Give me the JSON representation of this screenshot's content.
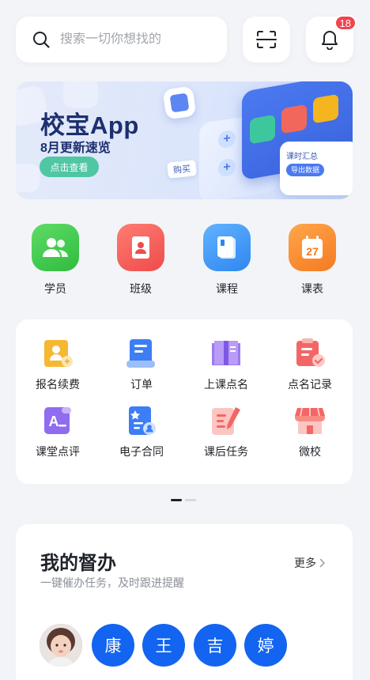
{
  "search": {
    "placeholder": "搜索一切你想找的"
  },
  "notifications": {
    "count": "18"
  },
  "banner": {
    "title": "校宝App",
    "subtitle": "8月更新速览",
    "button": "点击查看",
    "deco_buy": "购买",
    "deco_summary": "课时汇总",
    "deco_export": "导出数据"
  },
  "quick": [
    {
      "label": "学员",
      "icon": "students-icon",
      "color": "#3ecb4f"
    },
    {
      "label": "班级",
      "icon": "class-icon",
      "color": "#f45b5b"
    },
    {
      "label": "课程",
      "icon": "course-icon",
      "color": "#3b95f5"
    },
    {
      "label": "课表",
      "icon": "calendar-icon",
      "color": "#fb8a2d",
      "day": "27"
    }
  ],
  "grid": [
    {
      "label": "报名续费",
      "icon": "enroll-renew-icon"
    },
    {
      "label": "订单",
      "icon": "order-icon"
    },
    {
      "label": "上课点名",
      "icon": "roll-call-icon"
    },
    {
      "label": "点名记录",
      "icon": "roll-call-record-icon"
    },
    {
      "label": "课堂点评",
      "icon": "class-review-icon"
    },
    {
      "label": "电子合同",
      "icon": "e-contract-icon"
    },
    {
      "label": "课后任务",
      "icon": "homework-icon"
    },
    {
      "label": "微校",
      "icon": "micro-school-icon"
    }
  ],
  "supervise": {
    "title": "我的督办",
    "subtitle": "一键催办任务，及时跟进提醒",
    "more": "更多",
    "avatars": [
      "康",
      "王",
      "吉",
      "婷"
    ],
    "accent": "#1364f0"
  }
}
